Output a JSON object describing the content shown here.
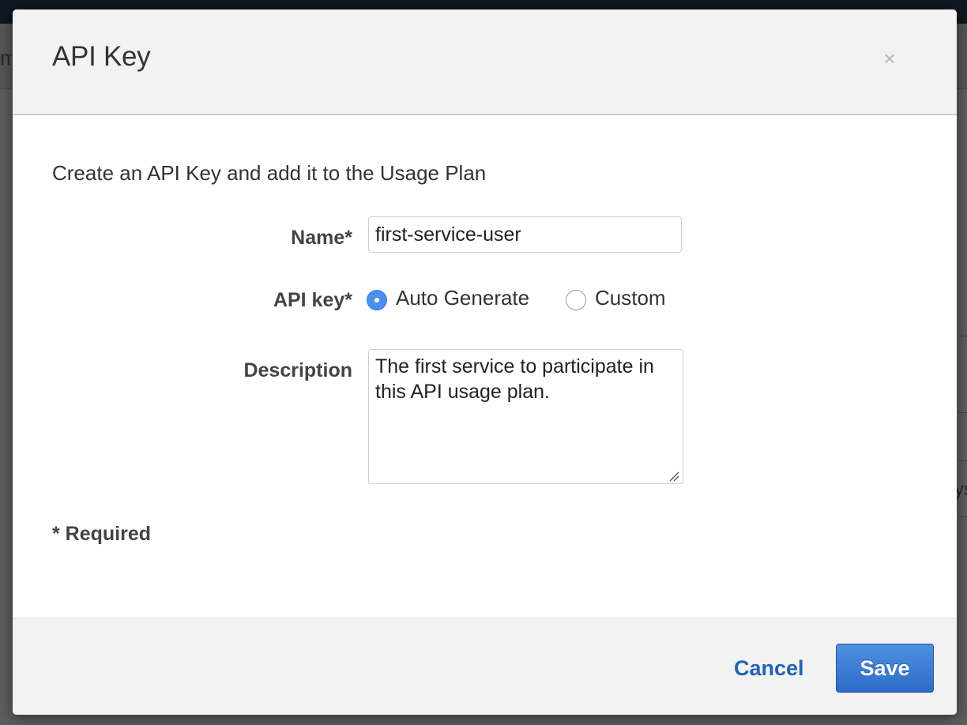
{
  "background": {
    "left_fragment": "m",
    "right_fragment": "ys"
  },
  "modal": {
    "title": "API Key",
    "close_icon": "close-icon",
    "close_glyph": "×",
    "intro": "Create an API Key and add it to the Usage Plan",
    "fields": {
      "name_label": "Name*",
      "name_value": "first-service-user",
      "api_key_label": "API key*",
      "api_key_options": [
        {
          "label": "Auto Generate",
          "selected": true
        },
        {
          "label": "Custom",
          "selected": false
        }
      ],
      "description_label": "Description",
      "description_value": "The first service to participate in this API usage plan."
    },
    "required_note": "* Required",
    "footer": {
      "cancel_label": "Cancel",
      "save_label": "Save"
    }
  },
  "colors": {
    "accent": "#4b8ff0",
    "link": "#2463b0",
    "primary_button": "#2d6cc7"
  }
}
